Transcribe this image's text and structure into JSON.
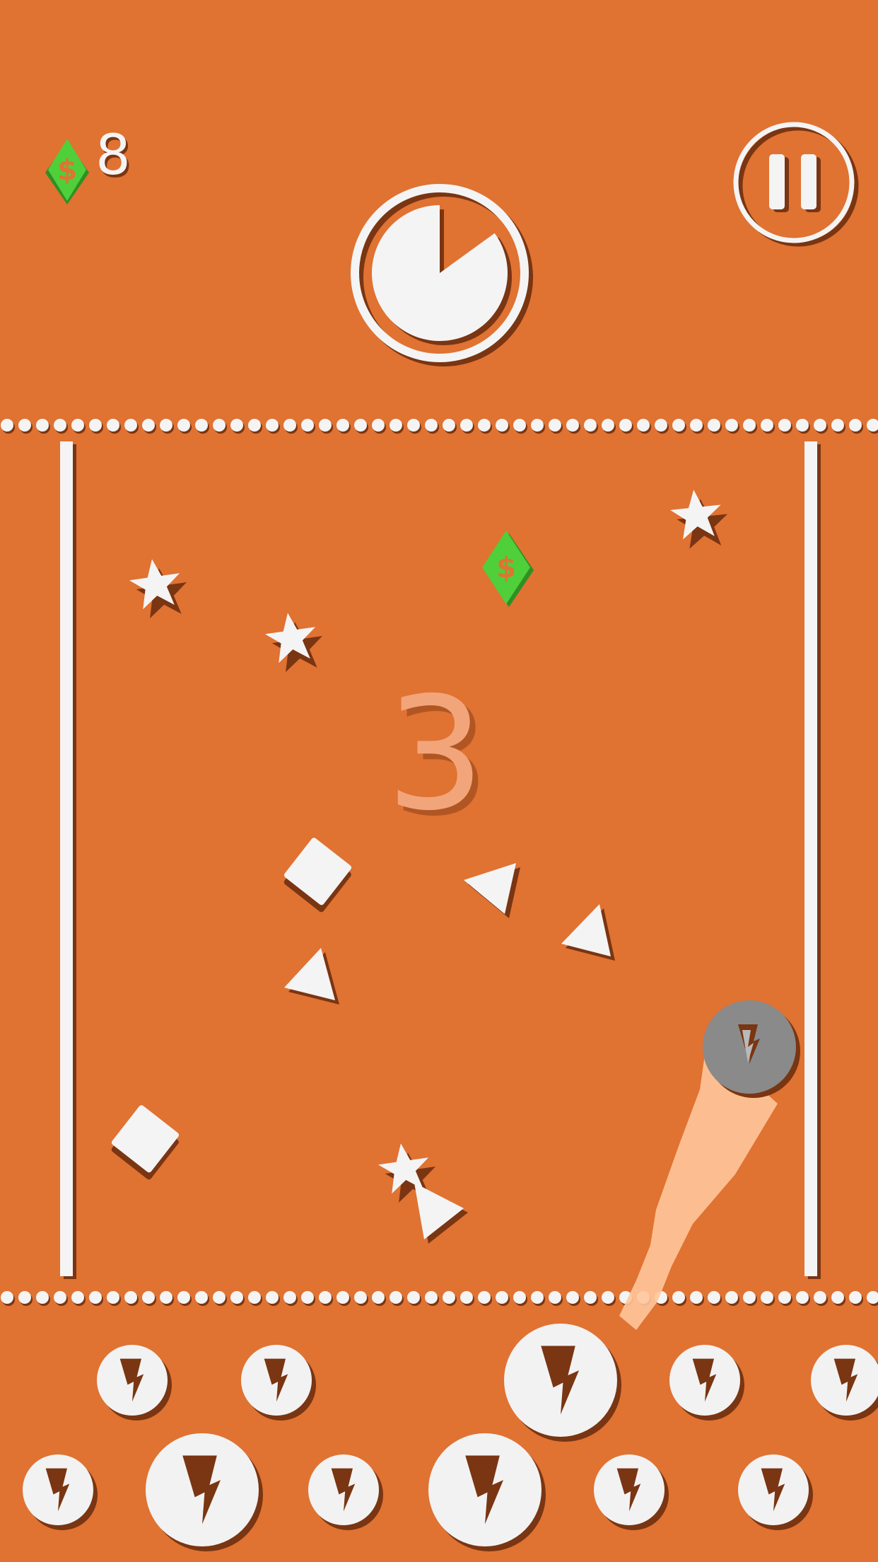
{
  "colors": {
    "background": "#e07232",
    "shadow": "#7a3512",
    "white": "#f4f4f4",
    "gem": "#4fcf3a",
    "gem_dark": "#2f8f23",
    "ball": "#8a8a8a",
    "trail": "#ffc79b",
    "countdown": "#f2a57a"
  },
  "hud": {
    "gems": "8",
    "gem_symbol": "$"
  },
  "timer": {
    "remaining_fraction": 0.85
  },
  "board": {
    "countdown": "3"
  }
}
